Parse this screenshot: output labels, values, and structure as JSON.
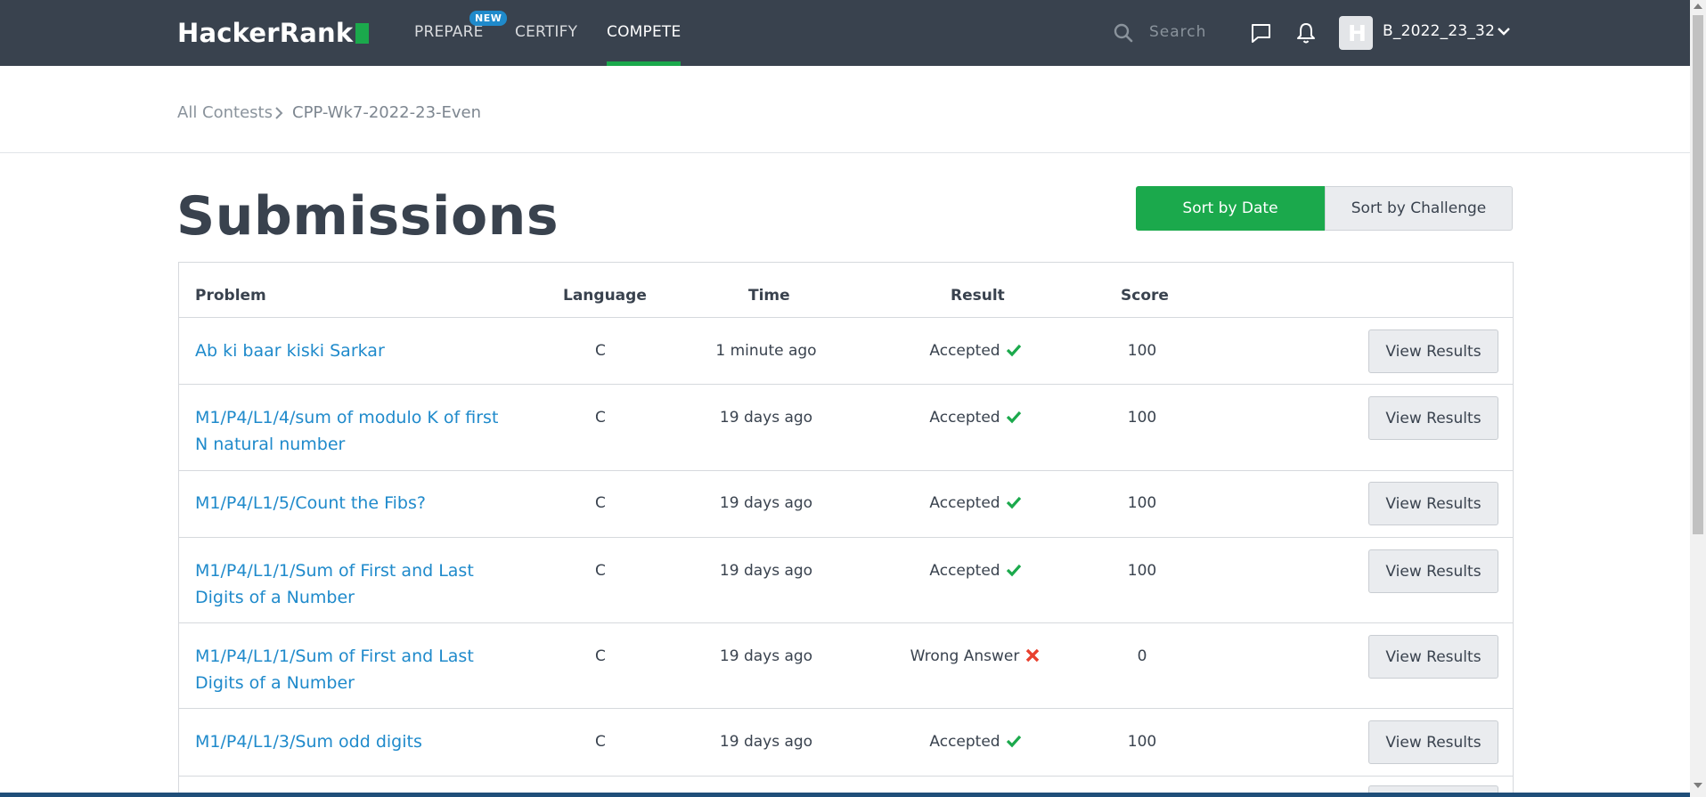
{
  "nav": {
    "logo": "HackerRank",
    "items": [
      {
        "label": "PREPARE",
        "badge": "NEW"
      },
      {
        "label": "CERTIFY"
      },
      {
        "label": "COMPETE",
        "active": true
      }
    ],
    "search_placeholder": "Search",
    "username": "B_2022_23_32",
    "avatar_letter": "H"
  },
  "breadcrumb": {
    "root": "All Contests",
    "current": "CPP-Wk7-2022-23-Even"
  },
  "page": {
    "title": "Submissions",
    "sort_date_label": "Sort by Date",
    "sort_challenge_label": "Sort by Challenge",
    "active_sort": "date"
  },
  "table": {
    "headers": [
      "Problem",
      "Language",
      "Time",
      "Result",
      "Score"
    ],
    "view_label": "View Results",
    "rows": [
      {
        "problem": "Ab ki baar kiski Sarkar",
        "language": "C",
        "time": "1 minute ago",
        "result": "Accepted",
        "status": "ok",
        "score": "100"
      },
      {
        "problem": "M1/P4/L1/4/sum of modulo K of first N natural number",
        "language": "C",
        "time": "19 days ago",
        "result": "Accepted",
        "status": "ok",
        "score": "100"
      },
      {
        "problem": "M1/P4/L1/5/Count the Fibs?",
        "language": "C",
        "time": "19 days ago",
        "result": "Accepted",
        "status": "ok",
        "score": "100"
      },
      {
        "problem": "M1/P4/L1/1/Sum of First and Last Digits of a Number",
        "language": "C",
        "time": "19 days ago",
        "result": "Accepted",
        "status": "ok",
        "score": "100"
      },
      {
        "problem": "M1/P4/L1/1/Sum of First and Last Digits of a Number",
        "language": "C",
        "time": "19 days ago",
        "result": "Wrong Answer",
        "status": "fail",
        "score": "0"
      },
      {
        "problem": "M1/P4/L1/3/Sum odd digits",
        "language": "C",
        "time": "19 days ago",
        "result": "Accepted",
        "status": "ok",
        "score": "100"
      }
    ]
  },
  "colors": {
    "nav_bg": "#39424e",
    "accent": "#1ba94c",
    "link": "#1f8acb",
    "ok": "#1ba94c",
    "fail": "#e8412f"
  }
}
